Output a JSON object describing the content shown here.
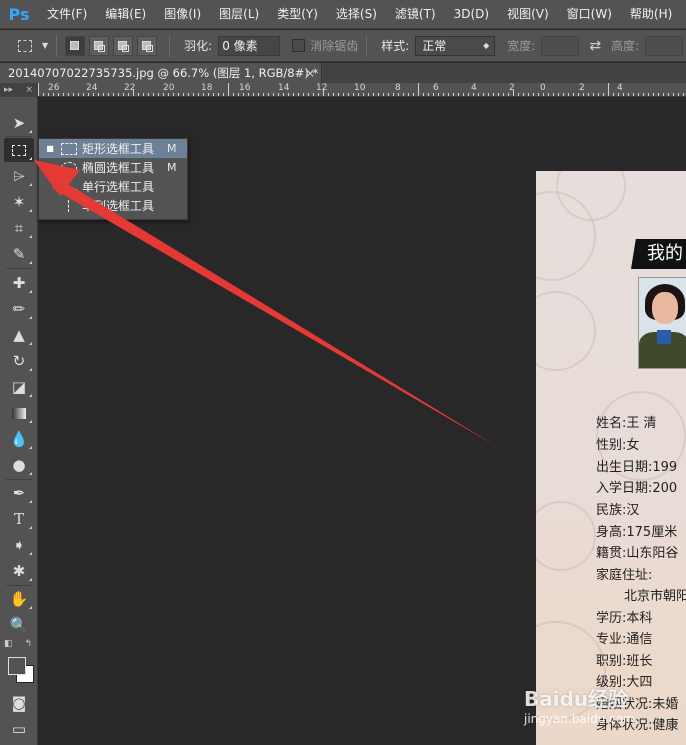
{
  "app": {
    "logo": "Ps"
  },
  "menubar": {
    "items": [
      "文件(F)",
      "编辑(E)",
      "图像(I)",
      "图层(L)",
      "类型(Y)",
      "选择(S)",
      "滤镜(T)",
      "3D(D)",
      "视图(V)",
      "窗口(W)",
      "帮助(H)"
    ]
  },
  "options": {
    "feather_label": "羽化:",
    "feather_value": "0 像素",
    "antialias_label": "消除锯齿",
    "style_label": "样式:",
    "style_value": "正常",
    "width_label": "宽度:",
    "height_label": "高度:"
  },
  "document_tab": {
    "title": "20140707022735735.jpg @ 66.7% (图层 1, RGB/8#) *",
    "close": "×"
  },
  "ruler": {
    "labels": [
      "26",
      "24",
      "22",
      "20",
      "18",
      "16",
      "14",
      "12",
      "10",
      "8",
      "6",
      "4",
      "2",
      "0",
      "2",
      "4"
    ]
  },
  "toolbar": {
    "collapse": "▸▸",
    "close": "×",
    "tools": [
      "move-icon",
      "rect-marquee-icon",
      "polygonal-lasso-icon",
      "magic-wand-icon",
      "crop-icon",
      "eyedropper-icon",
      "spot-healing-icon",
      "brush-icon",
      "clone-stamp-icon",
      "history-brush-icon",
      "eraser-icon",
      "gradient-icon",
      "blur-icon",
      "dodge-icon",
      "pen-icon",
      "type-icon",
      "path-selection-icon",
      "shape-icon",
      "hand-icon",
      "zoom-icon",
      "color-swatches-icon",
      "quick-mask-icon",
      "screen-mode-icon"
    ],
    "type_glyph": "T"
  },
  "flyout": {
    "items": [
      {
        "label": "矩形选框工具",
        "key": "M",
        "icon": "rect",
        "selected": true
      },
      {
        "label": "椭圆选框工具",
        "key": "M",
        "icon": "ellipse",
        "selected": false
      },
      {
        "label": "单行选框工具",
        "key": "",
        "icon": "row",
        "selected": false
      },
      {
        "label": "单列选框工具",
        "key": "",
        "icon": "col",
        "selected": false
      }
    ]
  },
  "document": {
    "title_text": "我的",
    "fields": [
      "姓名:王    清",
      "性别:女",
      "出生日期:199",
      "入学日期:200",
      "民族:汉",
      "身高:175厘米",
      "籍贯:山东阳谷",
      "家庭住址:",
      "北京市朝阳",
      "学历:本科",
      "专业:通信",
      "职别:班长",
      "级别:大四",
      "婚姻状况:未婚",
      "身体状况:健康"
    ]
  },
  "watermark": {
    "text": "Baidu经验",
    "sub": "jingyan.baidu.com"
  },
  "colors": {
    "accent": "#31a8ff",
    "annotation": "#e53935",
    "menu_hl": "#6e8096"
  }
}
